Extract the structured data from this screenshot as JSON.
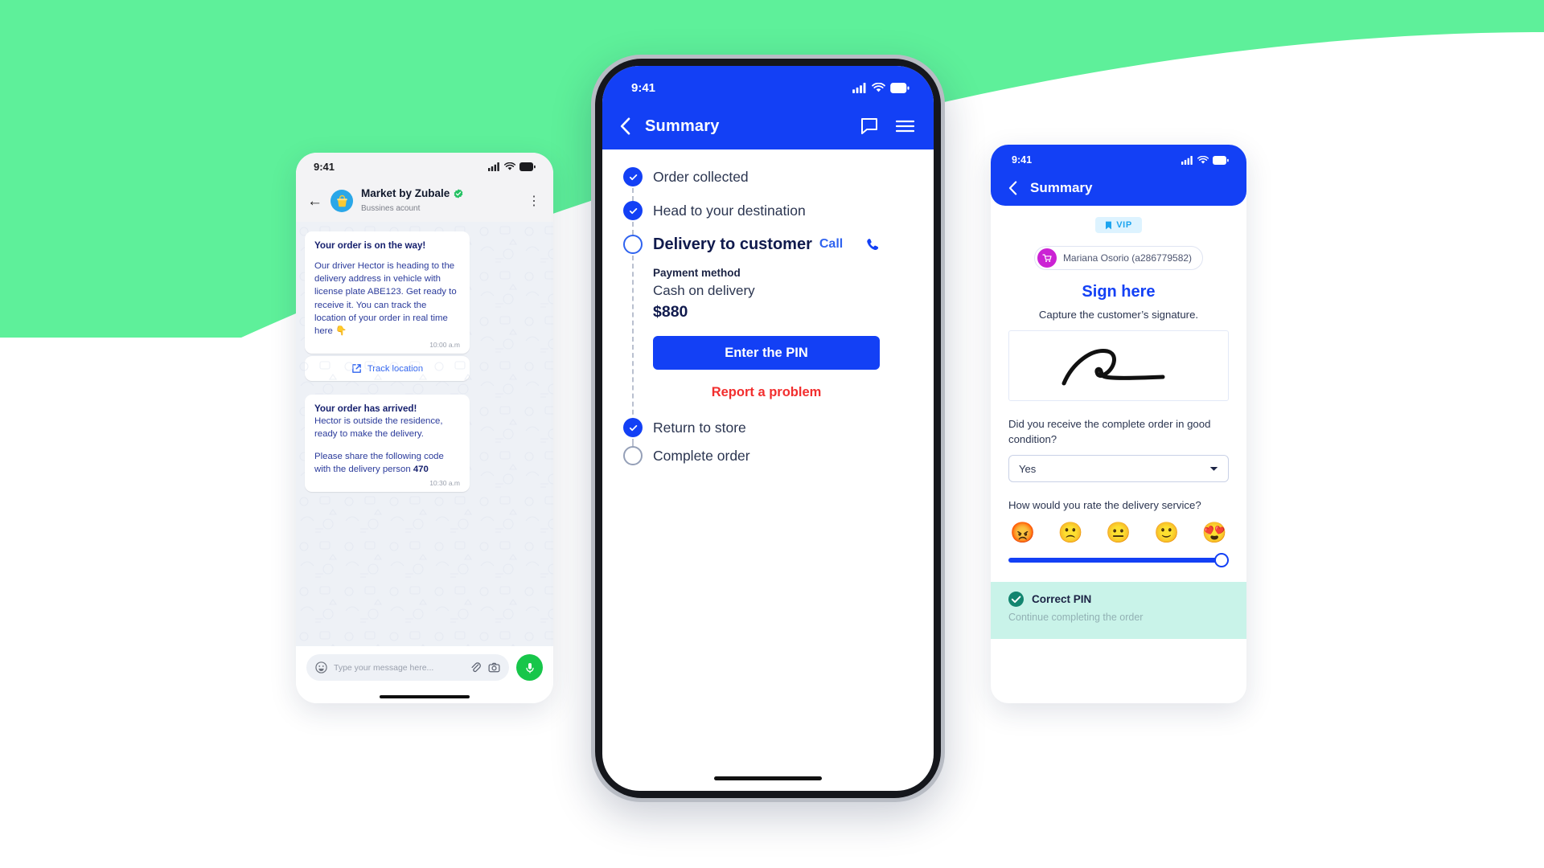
{
  "background": {
    "accent_green": "#5ef09a",
    "page_bg": "#ffffff"
  },
  "colors": {
    "brand_blue": "#1340f5",
    "link_blue": "#2f63ef",
    "danger_red": "#f22e2e",
    "whatsapp_green": "#17c64a",
    "vip_cyan": "#1ca4ef",
    "toast_mint": "#c9f3e9",
    "avatar_magenta": "#cb22d4"
  },
  "left_phone": {
    "status": {
      "time": "9:41",
      "signal_icon": "cellular-signal-icon",
      "wifi_icon": "wifi-icon",
      "battery_icon": "battery-icon"
    },
    "header": {
      "back_icon": "back-arrow-icon",
      "avatar_icon": "store-basket-avatar-icon",
      "name": "Market by Zubale",
      "verified_icon": "verified-badge-icon",
      "subtitle": "Bussines acount",
      "menu_icon": "overflow-menu-icon"
    },
    "messages": [
      {
        "title": "Your order is on the way!",
        "body": "Our driver Hector is heading to the delivery address in vehicle with license plate ABE123. Get ready to receive it. You can track the location of your order in real time here 👇",
        "time": "10:00 a.m"
      },
      {
        "title": "Your order has arrived!",
        "body_1": "Hector is outside the residence, ready to make the delivery.",
        "body_2_pre": "Please share the following code with the delivery person ",
        "body_2_code": "470",
        "time": "10:30 a.m"
      }
    ],
    "track_button": {
      "icon": "external-link-icon",
      "label": "Track location"
    },
    "input_bar": {
      "emoji_icon": "emoji-icon",
      "placeholder": "Type your message here...",
      "attach_icon": "paperclip-icon",
      "camera_icon": "camera-icon",
      "mic_icon": "microphone-icon"
    }
  },
  "center_phone": {
    "status": {
      "time": "9:41",
      "signal_icon": "cellular-signal-icon",
      "wifi_icon": "wifi-icon",
      "battery_icon": "battery-icon"
    },
    "header": {
      "back_icon": "chevron-left-icon",
      "title": "Summary",
      "chat_icon": "chat-bubble-icon",
      "menu_icon": "hamburger-menu-icon"
    },
    "steps": [
      {
        "label": "Order collected",
        "state": "done"
      },
      {
        "label": "Head to your destination",
        "state": "done"
      },
      {
        "label": "Delivery to customer",
        "state": "current"
      },
      {
        "label": "Return to store",
        "state": "done"
      },
      {
        "label": "Complete order",
        "state": "pending"
      }
    ],
    "delivery": {
      "call_label": "Call",
      "call_icon": "phone-icon",
      "payment_label": "Payment method",
      "payment_method": "Cash on delivery",
      "amount": "$880",
      "pin_button": "Enter the PIN",
      "report_link": "Report a problem"
    }
  },
  "right_phone": {
    "status": {
      "time": "9:41",
      "signal_icon": "cellular-signal-icon",
      "wifi_icon": "wifi-icon",
      "battery_icon": "battery-icon"
    },
    "header": {
      "back_icon": "chevron-left-icon",
      "title": "Summary"
    },
    "vip_badge": {
      "icon": "bookmark-icon",
      "label": "VIP"
    },
    "customer": {
      "avatar_icon": "shopping-cart-avatar-icon",
      "name": "Mariana Osorio (a286779582)"
    },
    "sign": {
      "title": "Sign here",
      "subtitle": "Capture the customer’s signature.",
      "canvas_icon": "signature-stroke"
    },
    "question_1": {
      "label": "Did you receive the complete order in good condition?",
      "value": "Yes",
      "chevron_icon": "chevron-down-icon"
    },
    "question_2": {
      "label": "How would you rate the delivery service?",
      "emojis": [
        "😡",
        "🙁",
        "😐",
        "🙂",
        "😍"
      ],
      "slider_value": 100
    },
    "toast": {
      "icon": "check-circle-icon",
      "title": "Correct PIN",
      "subtitle": "Continue completing the order"
    }
  }
}
